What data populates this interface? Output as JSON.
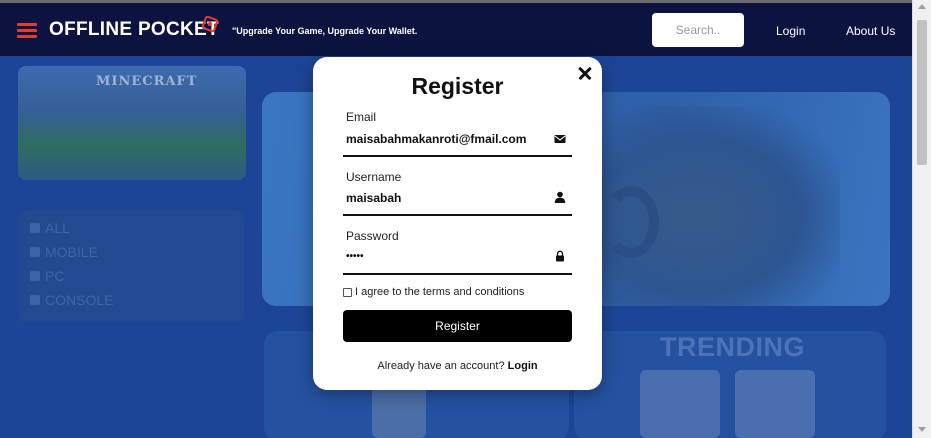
{
  "navbar": {
    "brand": "OFFLINE POCKET",
    "tagline": "\"Upgrade Your Game, Upgrade Your Wallet.",
    "search_placeholder": "Search..",
    "login_label": "Login",
    "about_label": "About Us"
  },
  "background": {
    "featured_game": "MINECRAFT",
    "categories": [
      "ALL",
      "MOBILE",
      "PC",
      "CONSOLE"
    ],
    "trending_title": "TRENDING"
  },
  "modal": {
    "title": "Register",
    "email_label": "Email",
    "email_value": "maisabahmakanroti@fmail.com",
    "username_label": "Username",
    "username_value": "maisabah",
    "password_label": "Password",
    "password_value": "•••••",
    "terms_text": "I agree to the terms and conditions",
    "terms_checked": false,
    "register_button": "Register",
    "footer_prompt": "Already have an account?",
    "footer_login": "Login"
  },
  "colors": {
    "navbar_bg": "#0d1340",
    "accent_red": "#e63b2e",
    "page_bg": "#1d4597",
    "button_bg": "#000000"
  }
}
